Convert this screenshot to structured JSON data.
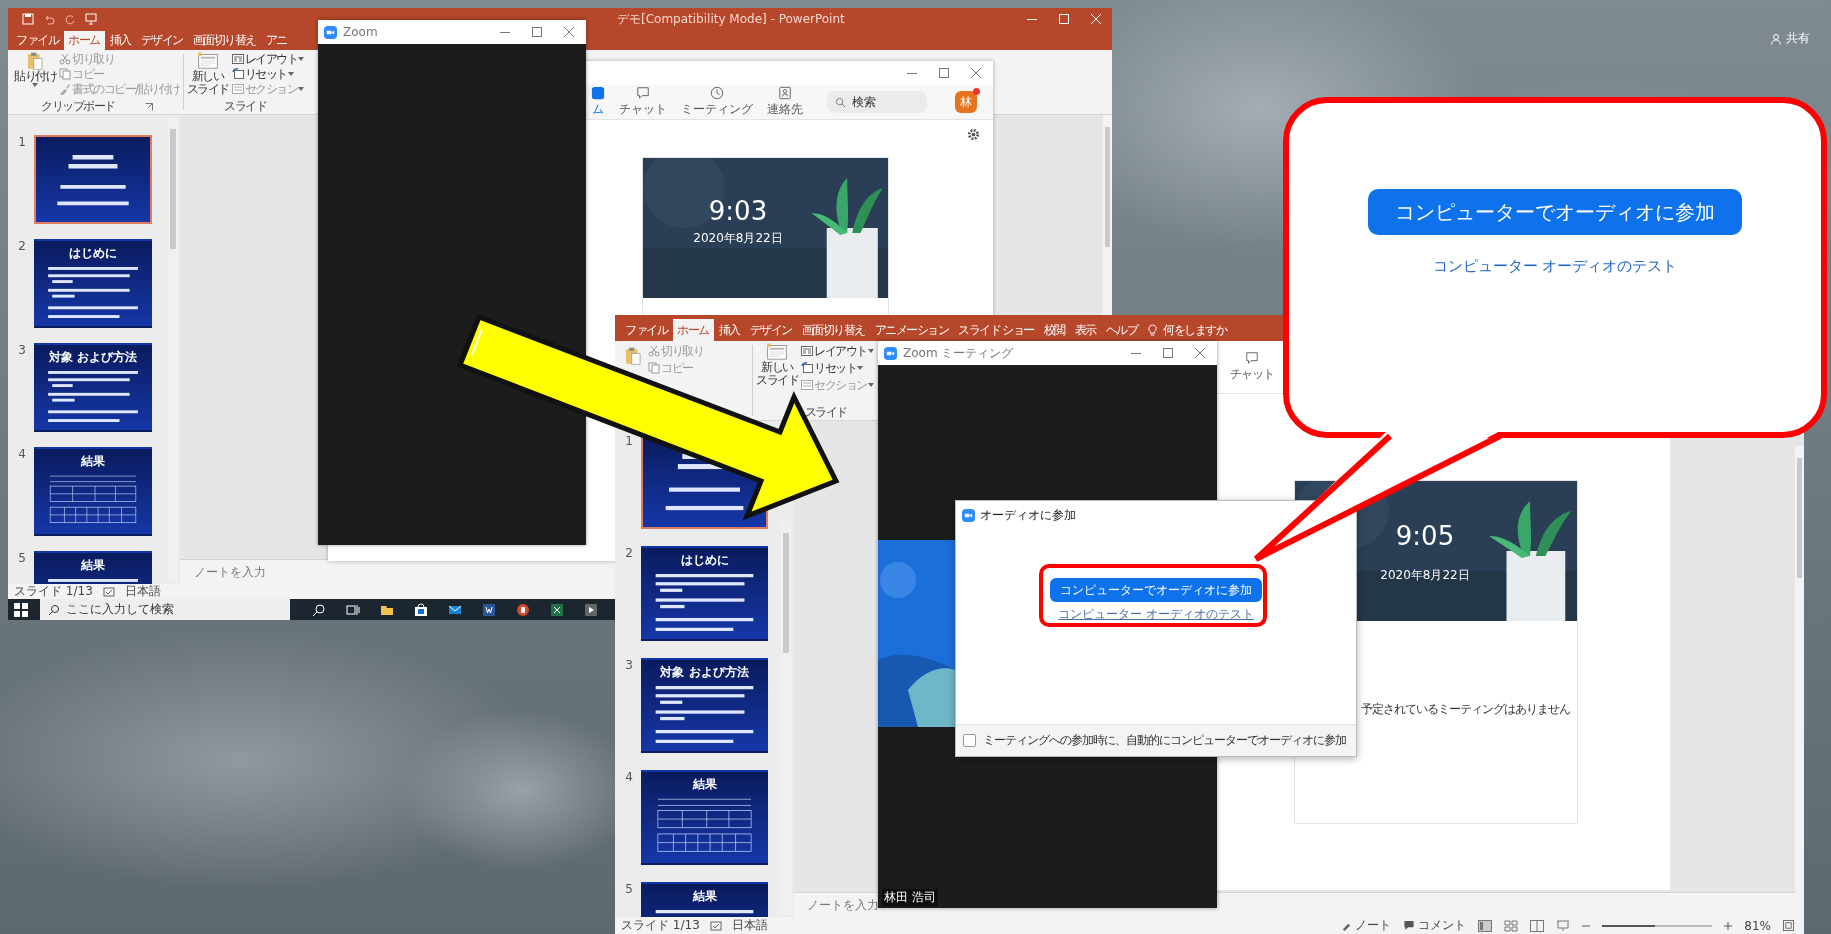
{
  "screenshot_1": {
    "powerpoint": {
      "title": "デモ[Compatibility Mode]  -  PowerPoint",
      "tabs": [
        {
          "label": "ファイル",
          "selected": false
        },
        {
          "label": "ホーム",
          "selected": true
        },
        {
          "label": "挿入",
          "selected": false
        },
        {
          "label": "デザイン",
          "selected": false
        },
        {
          "label": "画面切り替え",
          "selected": false
        },
        {
          "label": "アニ",
          "selected": false
        }
      ],
      "clipboard": {
        "paste": "貼り付け",
        "items": [
          {
            "label": "切り取り",
            "kind": "cut",
            "disabled": true
          },
          {
            "label": "コピー",
            "kind": "copy",
            "disabled": true
          },
          {
            "label": "書式のコピー/貼り付け",
            "kind": "format",
            "disabled": true
          }
        ],
        "group": "クリップボード"
      },
      "slides_group": {
        "new_slide": [
          "新しい",
          "スライド"
        ],
        "items": [
          {
            "label": "レイアウト",
            "kind": "layout",
            "disabled": false
          },
          {
            "label": "リセット",
            "kind": "reset",
            "disabled": false
          },
          {
            "label": "セクション",
            "kind": "section",
            "disabled": true
          }
        ],
        "group": "スライド"
      },
      "slides": [
        {
          "number": "1",
          "kind": "title",
          "selected": true
        },
        {
          "number": "2",
          "title": "はじめに",
          "kind": "bullets",
          "selected": false
        },
        {
          "number": "3",
          "title": "対象 および方法",
          "kind": "bullets",
          "selected": false
        },
        {
          "number": "4",
          "title": "結果",
          "kind": "table",
          "selected": false
        },
        {
          "number": "5",
          "title": "結果",
          "kind": "bullets",
          "selected": false
        }
      ],
      "notes_placeholder": "ノートを入力",
      "status_bar": {
        "slide": "スライド 1/13",
        "language": "日本語"
      }
    },
    "taskbar": {
      "search_placeholder": "ここに入力して検索"
    },
    "zoom_home": {
      "nav": [
        {
          "label": "ム",
          "kind": "home",
          "selected": true
        },
        {
          "label": "チャット",
          "kind": "chat",
          "selected": false
        },
        {
          "label": "ミーティング",
          "kind": "meeting",
          "selected": false
        },
        {
          "label": "連絡先",
          "kind": "contacts",
          "selected": false
        }
      ],
      "search_placeholder": "検索",
      "avatar": "林",
      "card": {
        "time": "9:03",
        "date": "2020年8月22日"
      }
    },
    "zoom_window": {
      "title": "Zoom"
    }
  },
  "share": "共有",
  "screenshot_2": {
    "powerpoint": {
      "tabs": [
        {
          "label": "ファイル",
          "selected": false
        },
        {
          "label": "ホーム",
          "selected": true
        },
        {
          "label": "挿入",
          "selected": false
        },
        {
          "label": "デザイン",
          "selected": false
        },
        {
          "label": "画面切り替え",
          "selected": false
        },
        {
          "label": "アニメーション",
          "selected": false
        },
        {
          "label": "スライド ショー",
          "selected": false
        },
        {
          "label": "校閲",
          "selected": false
        },
        {
          "label": "表示",
          "selected": false
        },
        {
          "label": "ヘルプ",
          "selected": false
        }
      ],
      "tell_me": "何をしますか",
      "clipboard": {
        "items": [
          {
            "label": "切り取り",
            "kind": "cut",
            "disabled": true
          },
          {
            "label": "コピー",
            "kind": "copy",
            "disabled": true
          }
        ]
      },
      "slides_group": {
        "new_slide": [
          "新しい",
          "スライド"
        ],
        "items": [
          {
            "label": "レイアウト",
            "kind": "layout",
            "disabled": false
          },
          {
            "label": "リセット",
            "kind": "reset",
            "disabled": false
          },
          {
            "label": "セクション",
            "kind": "section",
            "disabled": true
          }
        ],
        "group": "スライド"
      },
      "slides": [
        {
          "number": "1",
          "kind": "title",
          "selected": true
        },
        {
          "number": "2",
          "title": "はじめに",
          "kind": "bullets",
          "selected": false
        },
        {
          "number": "3",
          "title": "対象 および方法",
          "kind": "bullets",
          "selected": false
        },
        {
          "number": "4",
          "title": "結果",
          "kind": "table",
          "selected": false
        },
        {
          "number": "5",
          "title": "結果",
          "kind": "bullets",
          "selected": false
        }
      ],
      "notes_placeholder": "ノートを入力",
      "status_bar": {
        "slide": "スライド 1/13",
        "language": "日本語",
        "notes": "ノート",
        "comments": "コメント",
        "zoom": "81%",
        "zoom_level": {
          "level": 0.45
        }
      }
    },
    "zoom_home": {
      "nav": [
        {
          "label": "チャット",
          "kind": "chat",
          "selected": false
        }
      ],
      "card": {
        "time": "9:05",
        "date": "2020年8月22日"
      },
      "no_meetings": "予定されているミーティングはありません"
    },
    "meeting_window": {
      "title": "Zoom ミーティング",
      "participant": "林田 浩司"
    },
    "audio_dialog": {
      "title": "オーディオに参加",
      "join_button": "コンピューターでオーディオに参加",
      "test_link": "コンピューター オーディオのテスト",
      "auto_join": {
        "label": "ミーティングへの参加時に、自動的にコンピューターでオーディオに参加",
        "checked": false
      }
    }
  },
  "callout": {
    "join_button": "コンピューターでオーディオに参加",
    "test_link": "コンピューター オーディオのテスト"
  }
}
